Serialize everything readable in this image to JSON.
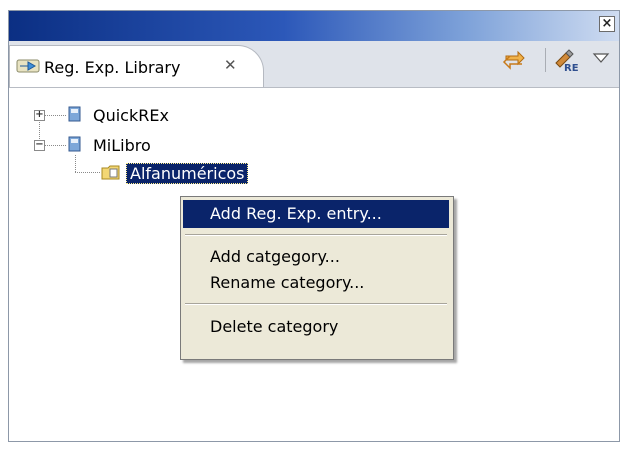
{
  "window": {
    "close_glyph": "×"
  },
  "tab": {
    "label": "Reg. Exp. Library",
    "close_glyph": "✕",
    "icon": "arrow-view-icon"
  },
  "toolbar": {
    "icons": [
      "sync-icon",
      "regex-re-icon",
      "view-menu-icon"
    ]
  },
  "tree": {
    "nodes": [
      {
        "label": "QuickREx",
        "expanded": false,
        "icon": "library-book-icon"
      },
      {
        "label": "MiLibro",
        "expanded": true,
        "icon": "library-book-icon",
        "children": [
          {
            "label": "Alfanuméricos",
            "selected": true,
            "icon": "folder-category-icon"
          }
        ]
      }
    ]
  },
  "context_menu": {
    "items": [
      {
        "label": "Add Reg. Exp. entry...",
        "active": true
      },
      {
        "label": "Add catgegory..."
      },
      {
        "label": "Rename category..."
      },
      {
        "label": "Delete category"
      }
    ]
  },
  "colors": {
    "selection": "#0a246a",
    "menu_bg": "#ece9d8",
    "title_start": "#0b2f83"
  }
}
